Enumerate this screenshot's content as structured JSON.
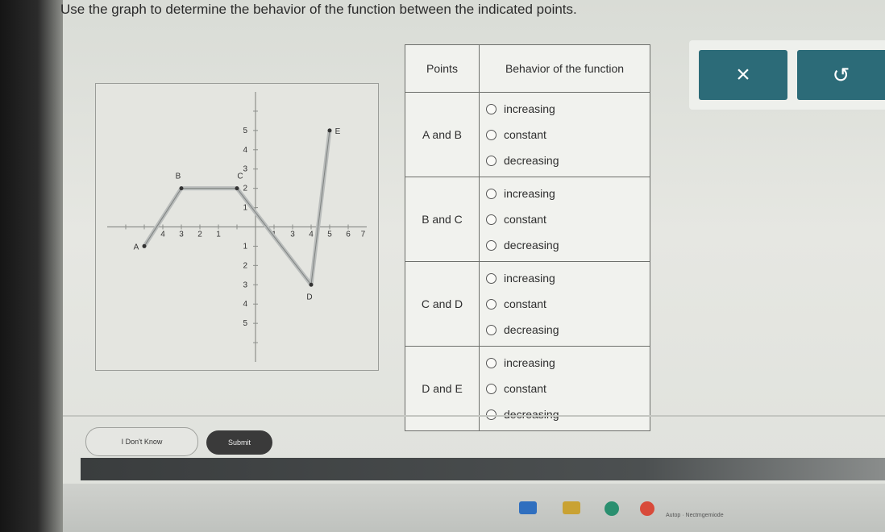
{
  "question": {
    "instruction": "Use the graph to determine the behavior of the function between the indicated points."
  },
  "graph": {
    "points": [
      {
        "label": "A",
        "x": -6,
        "y": -1
      },
      {
        "label": "B",
        "x": -4,
        "y": 2
      },
      {
        "label": "C",
        "x": -1,
        "y": 2
      },
      {
        "label": "D",
        "x": 3,
        "y": -3
      },
      {
        "label": "E",
        "x": 4,
        "y": 5
      }
    ],
    "xlim": [
      -8,
      6
    ],
    "ylim": [
      -7,
      7
    ],
    "x_ticks": [
      -7,
      -6,
      -5,
      -4,
      -3,
      -2,
      -1,
      1,
      2,
      3,
      4,
      5
    ],
    "y_ticks": [
      6,
      5,
      4,
      3,
      2,
      1,
      -1,
      -2,
      -3,
      -4,
      -5,
      -6
    ],
    "x_tick_labels": [
      "4",
      "3",
      "2",
      "1",
      "1",
      "3",
      "4",
      "5",
      "6",
      "7"
    ],
    "y_tick_labels": [
      "5",
      "4",
      "3",
      "2",
      "1",
      "1",
      "2",
      "3",
      "4",
      "5"
    ],
    "line_color": "#b9bcbb"
  },
  "table": {
    "header_points": "Points",
    "header_behavior": "Behavior of the function",
    "rows": [
      {
        "points": "A and B",
        "options": [
          "increasing",
          "constant",
          "decreasing"
        ]
      },
      {
        "points": "B and C",
        "options": [
          "increasing",
          "constant",
          "decreasing"
        ]
      },
      {
        "points": "C and D",
        "options": [
          "increasing",
          "constant",
          "decreasing"
        ]
      },
      {
        "points": "D and E",
        "options": [
          "increasing",
          "constant",
          "decreasing"
        ]
      }
    ]
  },
  "toolbar": {
    "close_icon": "×",
    "reset_icon": "↺",
    "accent": "#2c6b78"
  },
  "footer": {
    "dont_know_label": "I Don't Know",
    "submit_label": "Submit"
  },
  "taskbar": {
    "tray_text": "Autop · Nectmgemiode"
  }
}
